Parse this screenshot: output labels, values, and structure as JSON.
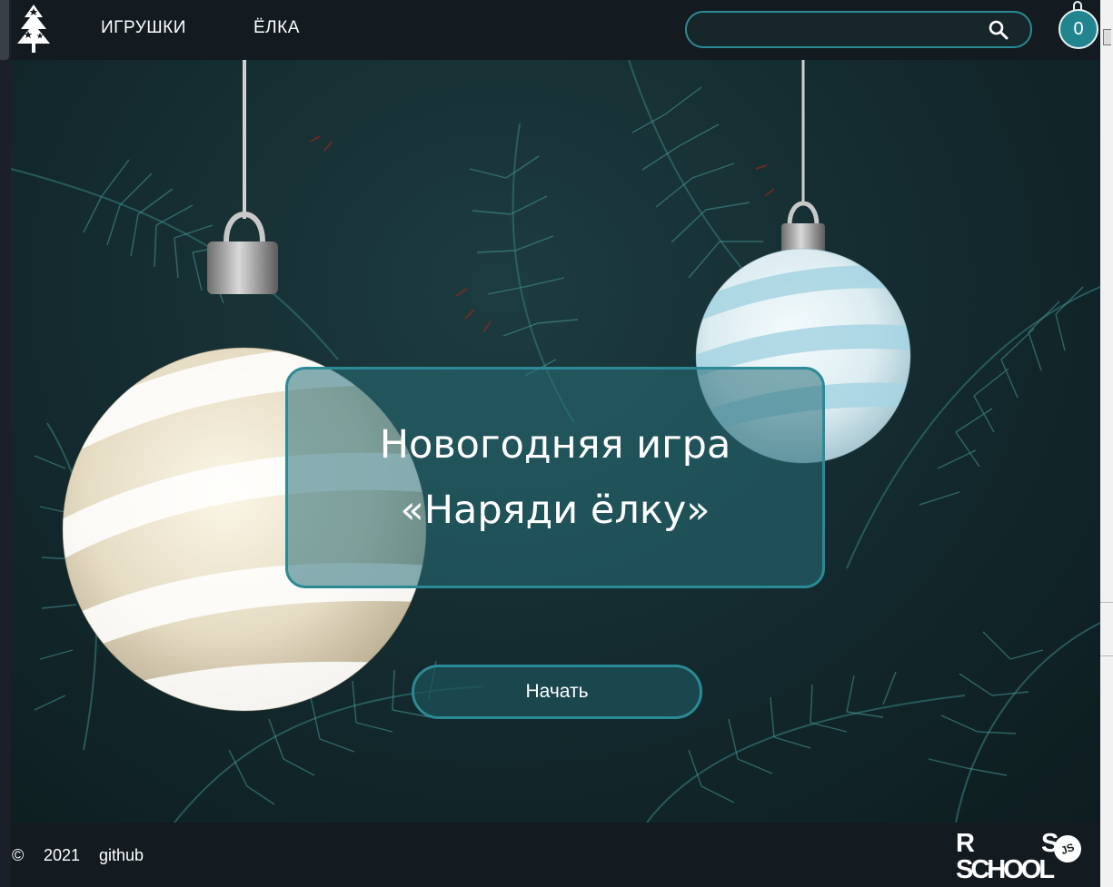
{
  "header": {
    "nav": [
      {
        "label": "ИГРУШКИ"
      },
      {
        "label": "ЁЛКА"
      }
    ],
    "search": {
      "placeholder": "",
      "value": "",
      "icon": "search-icon"
    },
    "counter": {
      "value": "0",
      "icon": "bauble-counter"
    }
  },
  "hero": {
    "title_line1": "Новогодняя игра",
    "title_line2": "«Наряди ёлку»",
    "start_label": "Начать"
  },
  "footer": {
    "copyright": "©",
    "year": "2021",
    "github": "github",
    "logo": {
      "line1_left": "R",
      "line1_right": "S",
      "line2": "SCHOOL",
      "badge": "JS"
    }
  },
  "colors": {
    "accent": "#2a8a96",
    "header_bg": "#131b20",
    "text": "#ffffff"
  }
}
